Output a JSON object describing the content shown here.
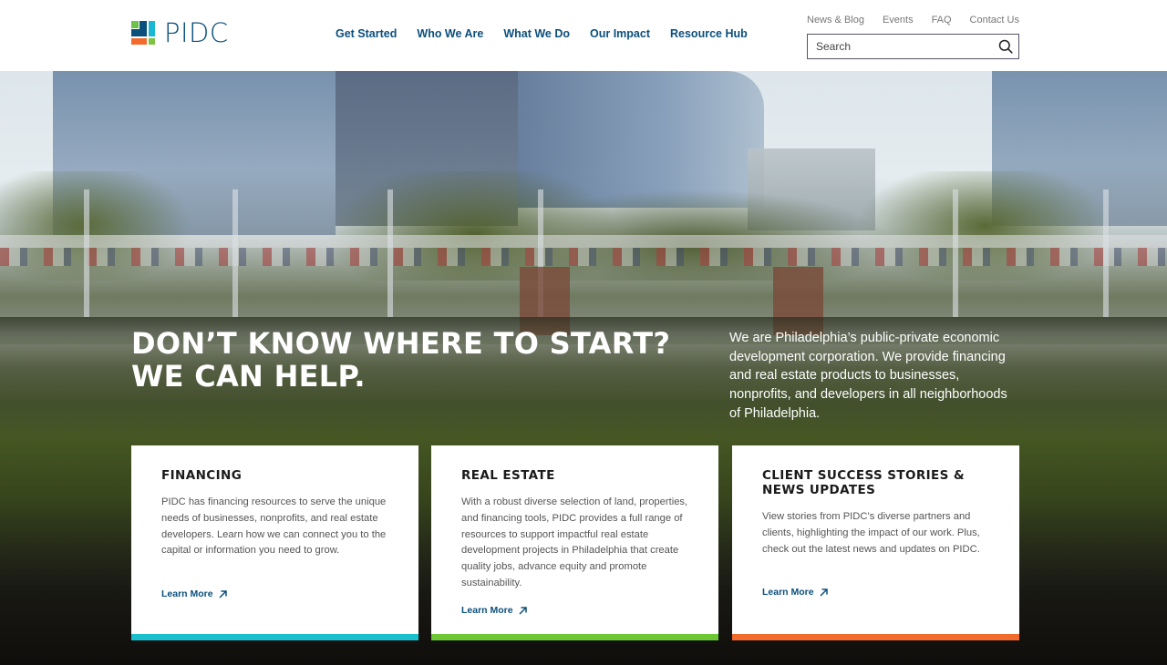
{
  "header": {
    "logo_text": "PIDC",
    "main_nav": [
      "Get Started",
      "Who We Are",
      "What We Do",
      "Our Impact",
      "Resource Hub"
    ],
    "utility_nav": [
      "News & Blog",
      "Events",
      "FAQ",
      "Contact Us"
    ],
    "search": {
      "placeholder": "Search",
      "value": "",
      "icon": "search-icon"
    }
  },
  "hero": {
    "title": "Don’t know where to start? We can help.",
    "description": "We are Philadelphia’s public-private economic development corporation. We provide financing and real estate products to businesses, nonprofits, and developers in all neighborhoods of Philadelphia."
  },
  "cards": [
    {
      "title": "Financing",
      "body": "PIDC has financing resources to serve the unique needs of businesses, nonprofits, and real estate developers. Learn how we can connect you to the capital or information you need to grow.",
      "link": "Learn More",
      "link_icon": "arrow-up-right-icon",
      "accent": "#17c0cc"
    },
    {
      "title": "Real Estate",
      "body": "With a robust diverse selection of land, properties, and financing tools, PIDC provides a full range of resources to support impactful real estate development projects in Philadelphia that create quality jobs, advance equity and promote sustainability.",
      "link": "Learn More",
      "link_icon": "arrow-up-right-icon",
      "accent": "#6cc732"
    },
    {
      "title": "Client Success Stories & News Updates",
      "body": "View stories from PIDC’s diverse partners and clients, highlighting the impact of our work. Plus, check out the latest news and updates on PIDC.",
      "link": "Learn More",
      "link_icon": "arrow-up-right-icon",
      "accent": "#f26a2c"
    }
  ],
  "colors": {
    "brand_blue": "#0b4f7c",
    "brand_cyan": "#1bb8d4",
    "brand_green": "#6cc24a",
    "brand_orange": "#f26a2c"
  }
}
